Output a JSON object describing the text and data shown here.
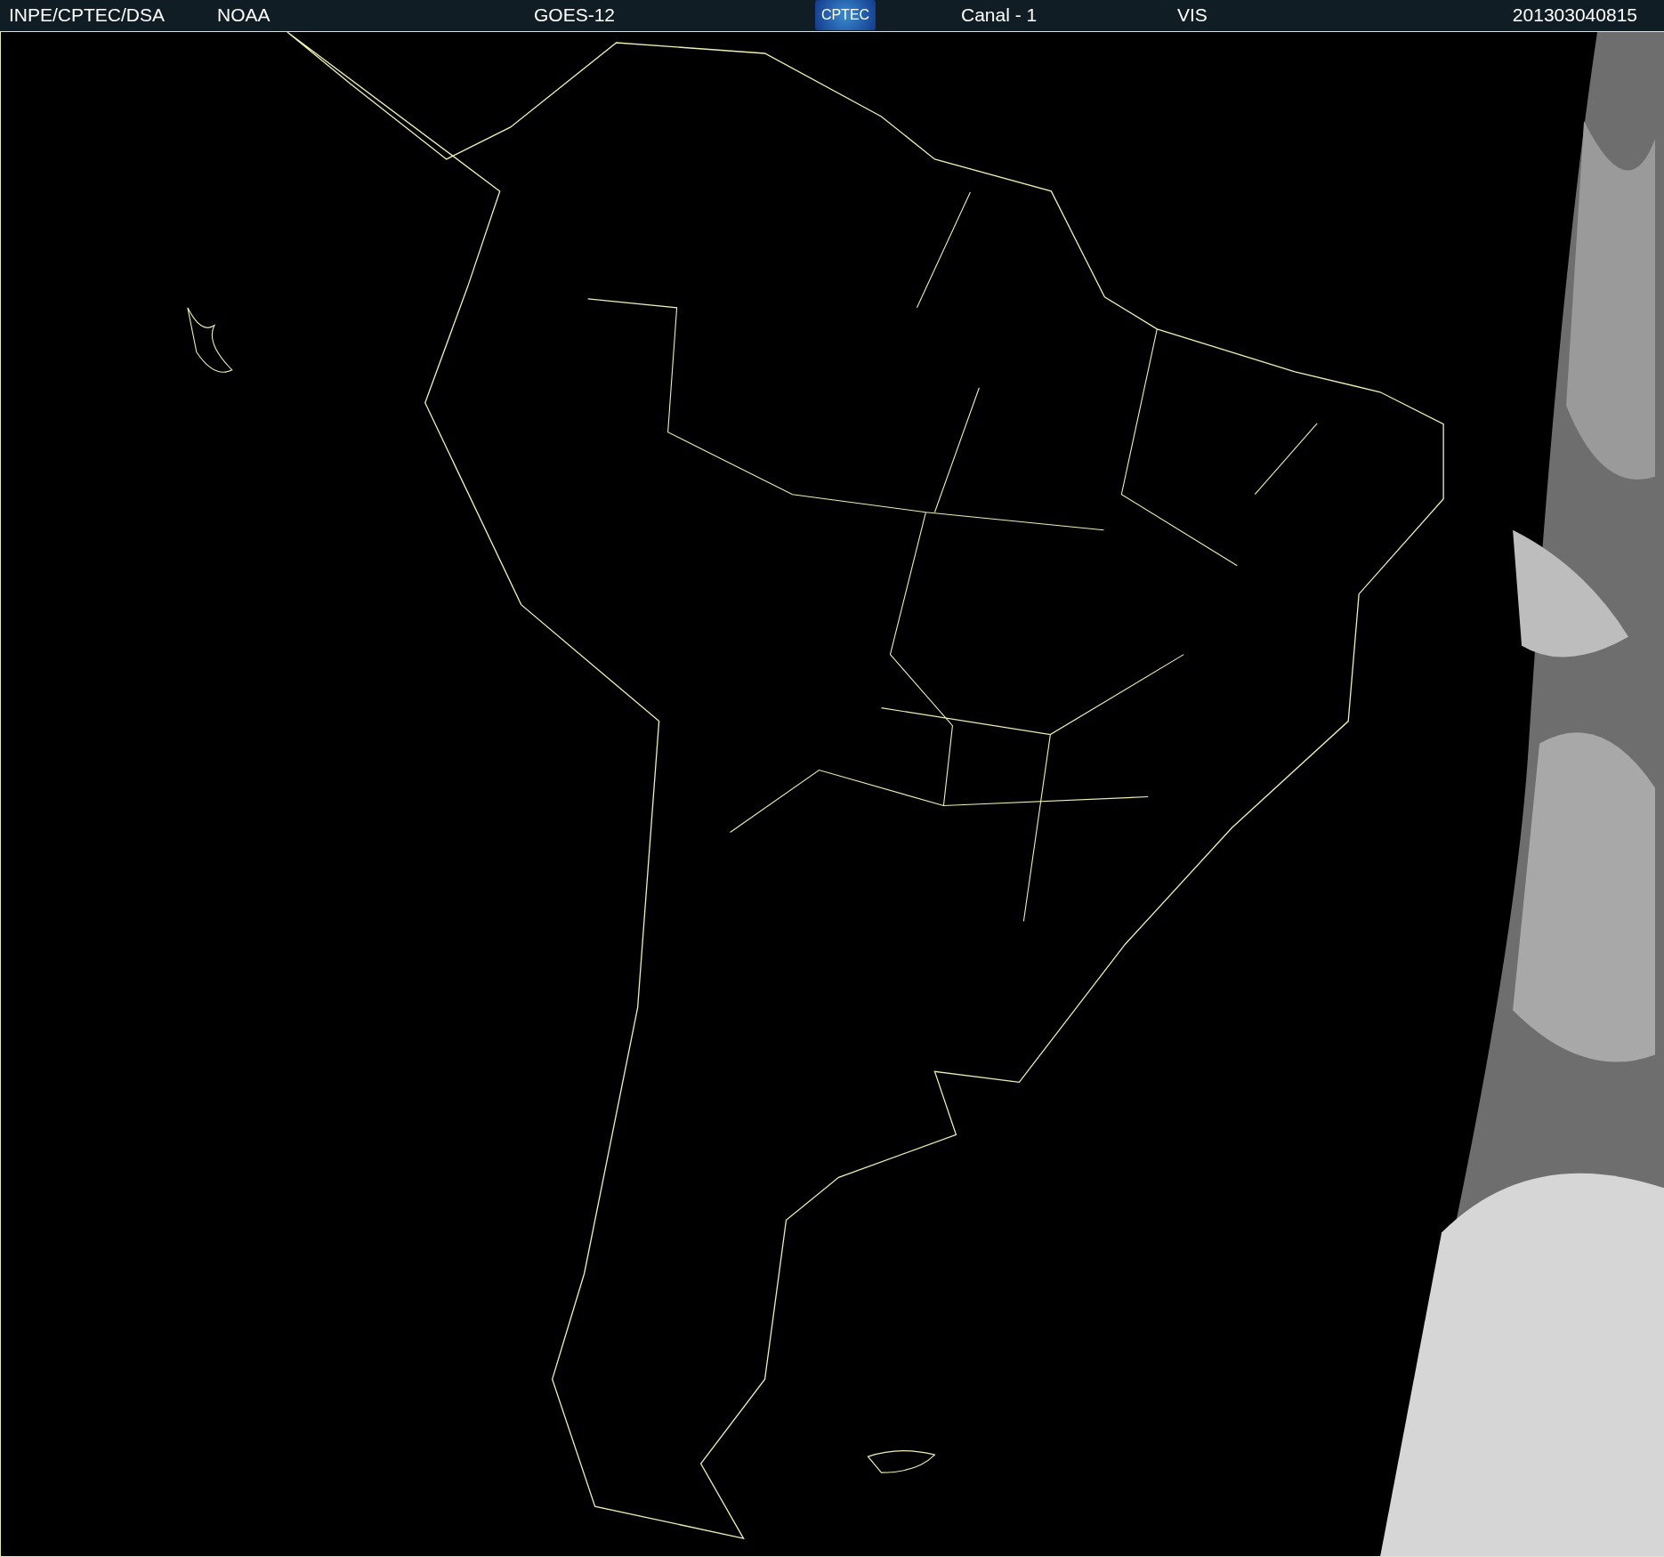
{
  "header": {
    "source": "INPE/CPTEC/DSA",
    "agency": "NOAA",
    "satellite": "GOES-12",
    "logo": "CPTEC",
    "channel": "Canal - 1",
    "band": "VIS",
    "timestamp": "201303040815"
  }
}
